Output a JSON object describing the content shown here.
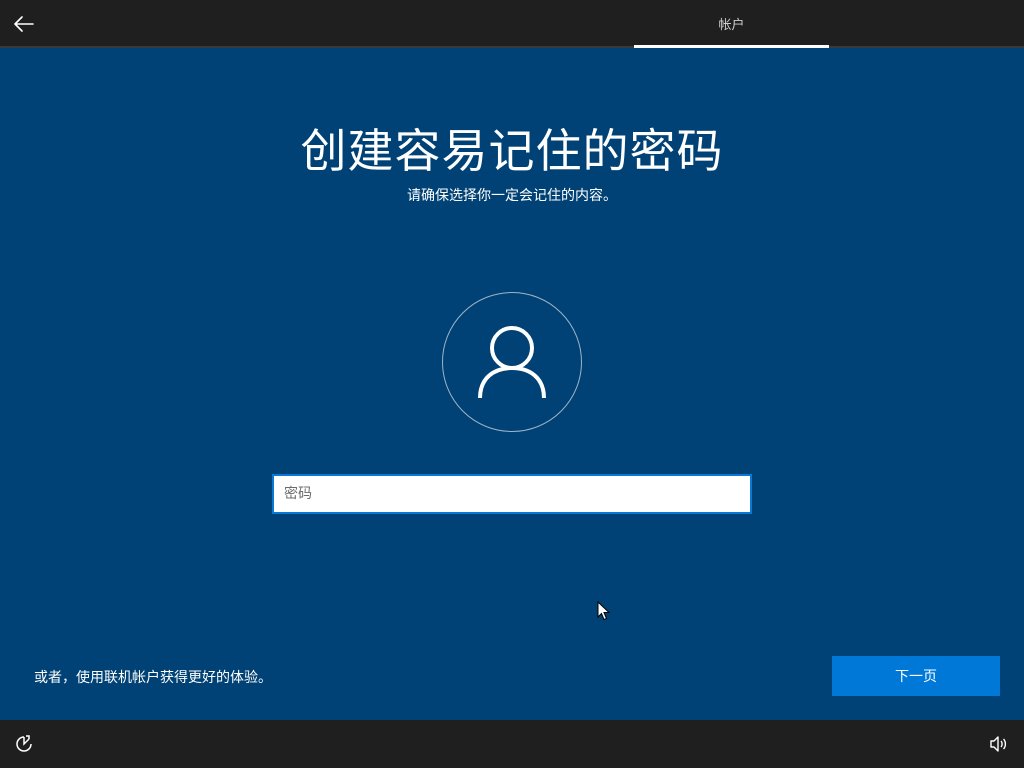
{
  "header": {
    "back_icon": "arrow-left-icon",
    "tab_label": "帐户"
  },
  "main": {
    "title": "创建容易记住的密码",
    "subtitle": "请确保选择你一定会记住的内容。",
    "avatar_icon": "user-icon",
    "password": {
      "value": "",
      "placeholder": "密码"
    }
  },
  "footer": {
    "alt_link": "或者，使用联机帐户获得更好的体验。",
    "next_label": "下一页"
  },
  "taskbar": {
    "left_icon": "ease-of-access-icon",
    "right_icon": "volume-icon"
  },
  "colors": {
    "background": "#004275",
    "bar": "#1f1f1f",
    "accent": "#0078d7"
  }
}
